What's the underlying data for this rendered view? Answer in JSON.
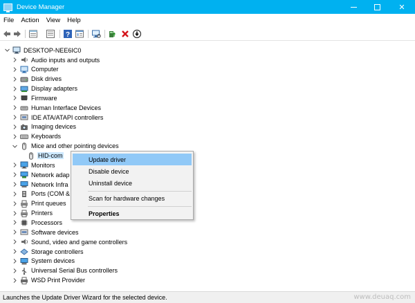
{
  "window": {
    "title": "Device Manager",
    "minimize_icon": "minimize-icon",
    "maximize_icon": "maximize-icon",
    "close_glyph": "✕"
  },
  "menu": [
    "File",
    "Action",
    "View",
    "Help"
  ],
  "toolbar": {
    "icons": [
      "back-arrow-icon",
      "forward-arrow-icon",
      "properties-icon",
      "show-hide-console-tree-icon",
      "help-icon",
      "view-icon",
      "scan-hardware-icon",
      "update-driver-icon",
      "uninstall-icon",
      "disable-device-icon"
    ]
  },
  "tree": {
    "root": "DESKTOP-NEE6IC0",
    "items": [
      {
        "label": "Audio inputs and outputs",
        "expanded": false,
        "icon": "speaker-icon"
      },
      {
        "label": "Computer",
        "expanded": false,
        "icon": "computer-icon"
      },
      {
        "label": "Disk drives",
        "expanded": false,
        "icon": "disk-drive-icon"
      },
      {
        "label": "Display adapters",
        "expanded": false,
        "icon": "display-adapter-icon"
      },
      {
        "label": "Firmware",
        "expanded": false,
        "icon": "firmware-icon"
      },
      {
        "label": "Human Interface Devices",
        "expanded": false,
        "icon": "hid-icon"
      },
      {
        "label": "IDE ATA/ATAPI controllers",
        "expanded": false,
        "icon": "ide-controller-icon"
      },
      {
        "label": "Imaging devices",
        "expanded": false,
        "icon": "camera-icon"
      },
      {
        "label": "Keyboards",
        "expanded": false,
        "icon": "keyboard-icon"
      },
      {
        "label": "Mice and other pointing devices",
        "expanded": true,
        "icon": "mouse-icon"
      },
      {
        "label": "HID-com",
        "child": true,
        "icon": "mouse-icon"
      },
      {
        "label": "Monitors",
        "expanded": false,
        "icon": "monitor-icon"
      },
      {
        "label": "Network adap",
        "expanded": false,
        "icon": "network-adapter-icon"
      },
      {
        "label": "Network Infra",
        "expanded": false,
        "icon": "network-infrastructure-icon"
      },
      {
        "label": "Ports (COM &",
        "expanded": false,
        "icon": "port-icon"
      },
      {
        "label": "Print queues",
        "expanded": false,
        "icon": "printer-icon"
      },
      {
        "label": "Printers",
        "expanded": false,
        "icon": "printer-icon"
      },
      {
        "label": "Processors",
        "expanded": false,
        "icon": "processor-icon"
      },
      {
        "label": "Software devices",
        "expanded": false,
        "icon": "software-device-icon"
      },
      {
        "label": "Sound, video and game controllers",
        "expanded": false,
        "icon": "sound-icon"
      },
      {
        "label": "Storage controllers",
        "expanded": false,
        "icon": "storage-controller-icon"
      },
      {
        "label": "System devices",
        "expanded": false,
        "icon": "system-device-icon"
      },
      {
        "label": "Universal Serial Bus controllers",
        "expanded": false,
        "icon": "usb-icon"
      },
      {
        "label": "WSD Print Provider",
        "expanded": false,
        "icon": "wsd-printer-icon"
      }
    ]
  },
  "context_menu": {
    "items": [
      {
        "label": "Update driver",
        "highlighted": true
      },
      {
        "label": "Disable device"
      },
      {
        "label": "Uninstall device"
      },
      {
        "label": "Scan for hardware changes"
      },
      {
        "label": "Properties",
        "bold": true
      }
    ]
  },
  "status": "Launches the Update Driver Wizard for the selected device.",
  "watermark": "www.deuaq.com",
  "colors": {
    "titlebar": "#00b1f0",
    "menu_highlight": "#91c9f7",
    "selection": "#cce8ff"
  }
}
